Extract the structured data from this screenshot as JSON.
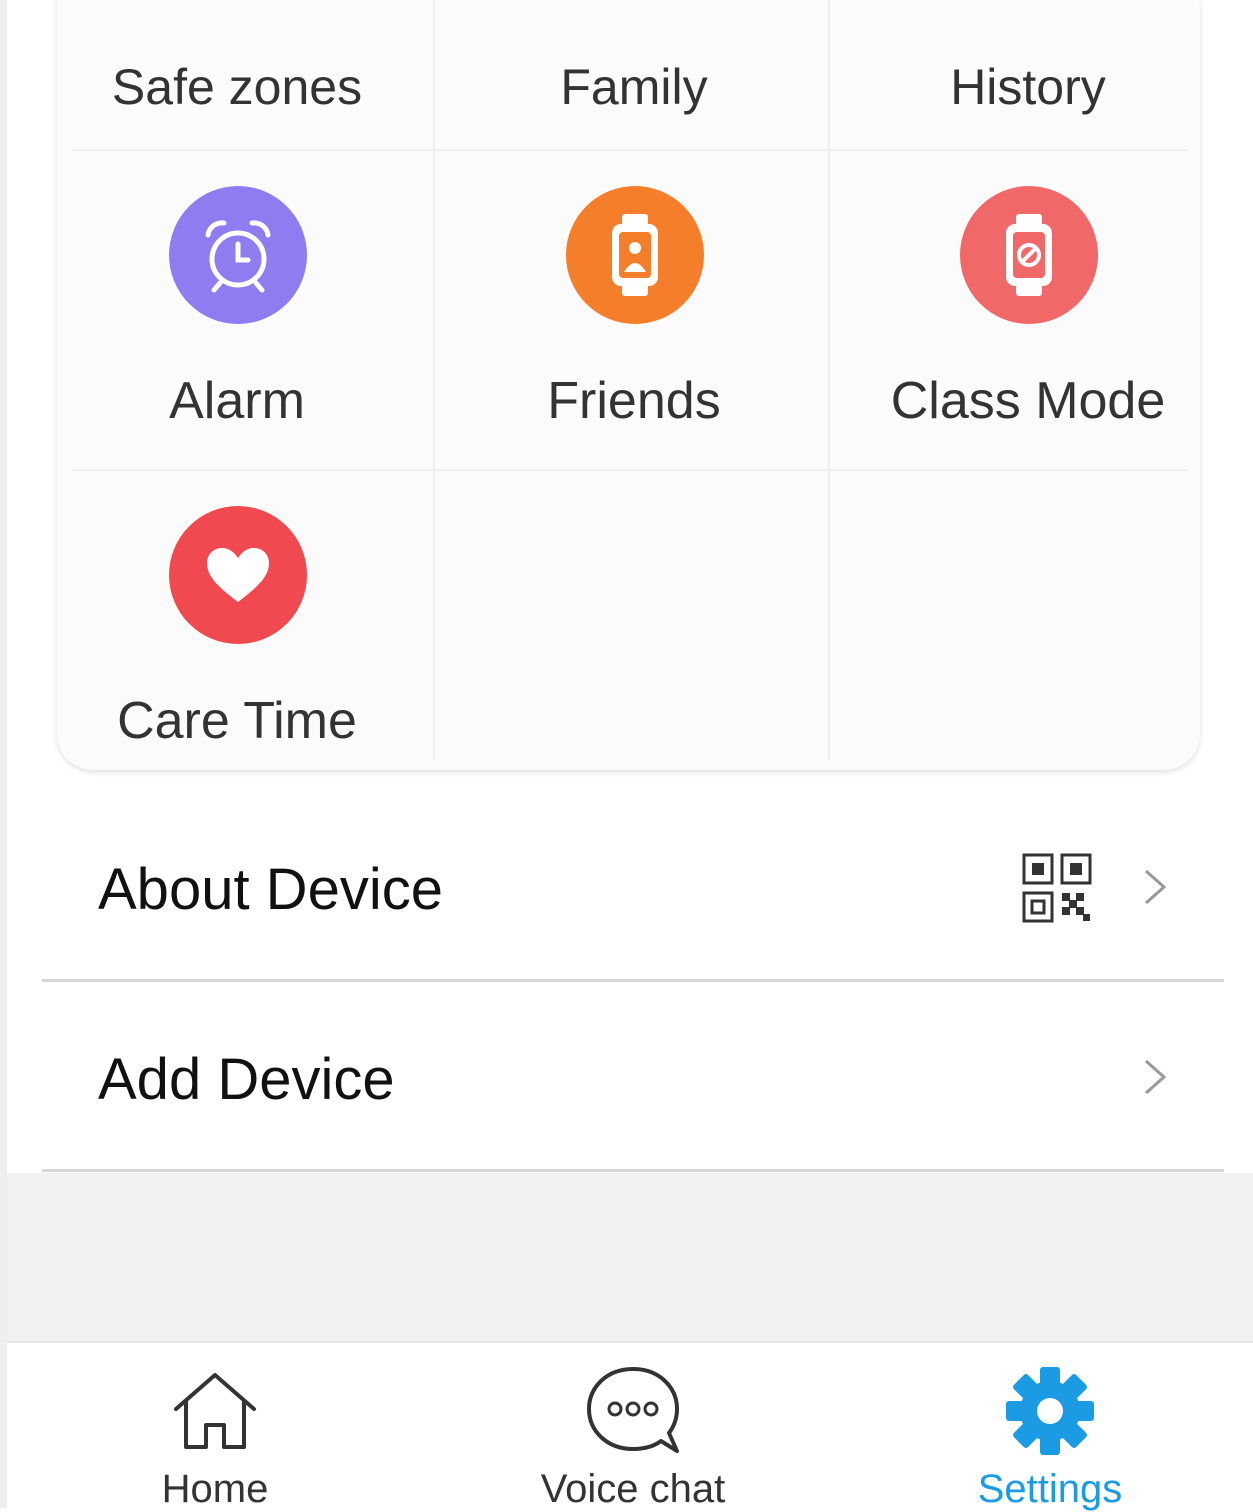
{
  "grid": {
    "top_row": [
      {
        "label": "Safe zones"
      },
      {
        "label": "Family"
      },
      {
        "label": "History"
      }
    ],
    "features": [
      {
        "label": "Alarm",
        "icon": "alarm-clock-icon",
        "color": "#8e7cf0"
      },
      {
        "label": "Friends",
        "icon": "watch-contact-icon",
        "color": "#f57e2a"
      },
      {
        "label": "Class Mode",
        "icon": "watch-block-icon",
        "color": "#f06868"
      },
      {
        "label": "Care Time",
        "icon": "heart-icon",
        "color": "#f04a50"
      }
    ]
  },
  "menu": [
    {
      "label": "About Device",
      "icon": "qr-code-icon"
    },
    {
      "label": "Add Device"
    }
  ],
  "tabs": [
    {
      "label": "Home",
      "icon": "home-icon"
    },
    {
      "label": "Voice chat",
      "icon": "chat-bubble-icon"
    },
    {
      "label": "Settings",
      "icon": "gear-icon",
      "active": true
    }
  ],
  "colors": {
    "accent": "#1a9be3",
    "band": "#f2f2f2"
  }
}
